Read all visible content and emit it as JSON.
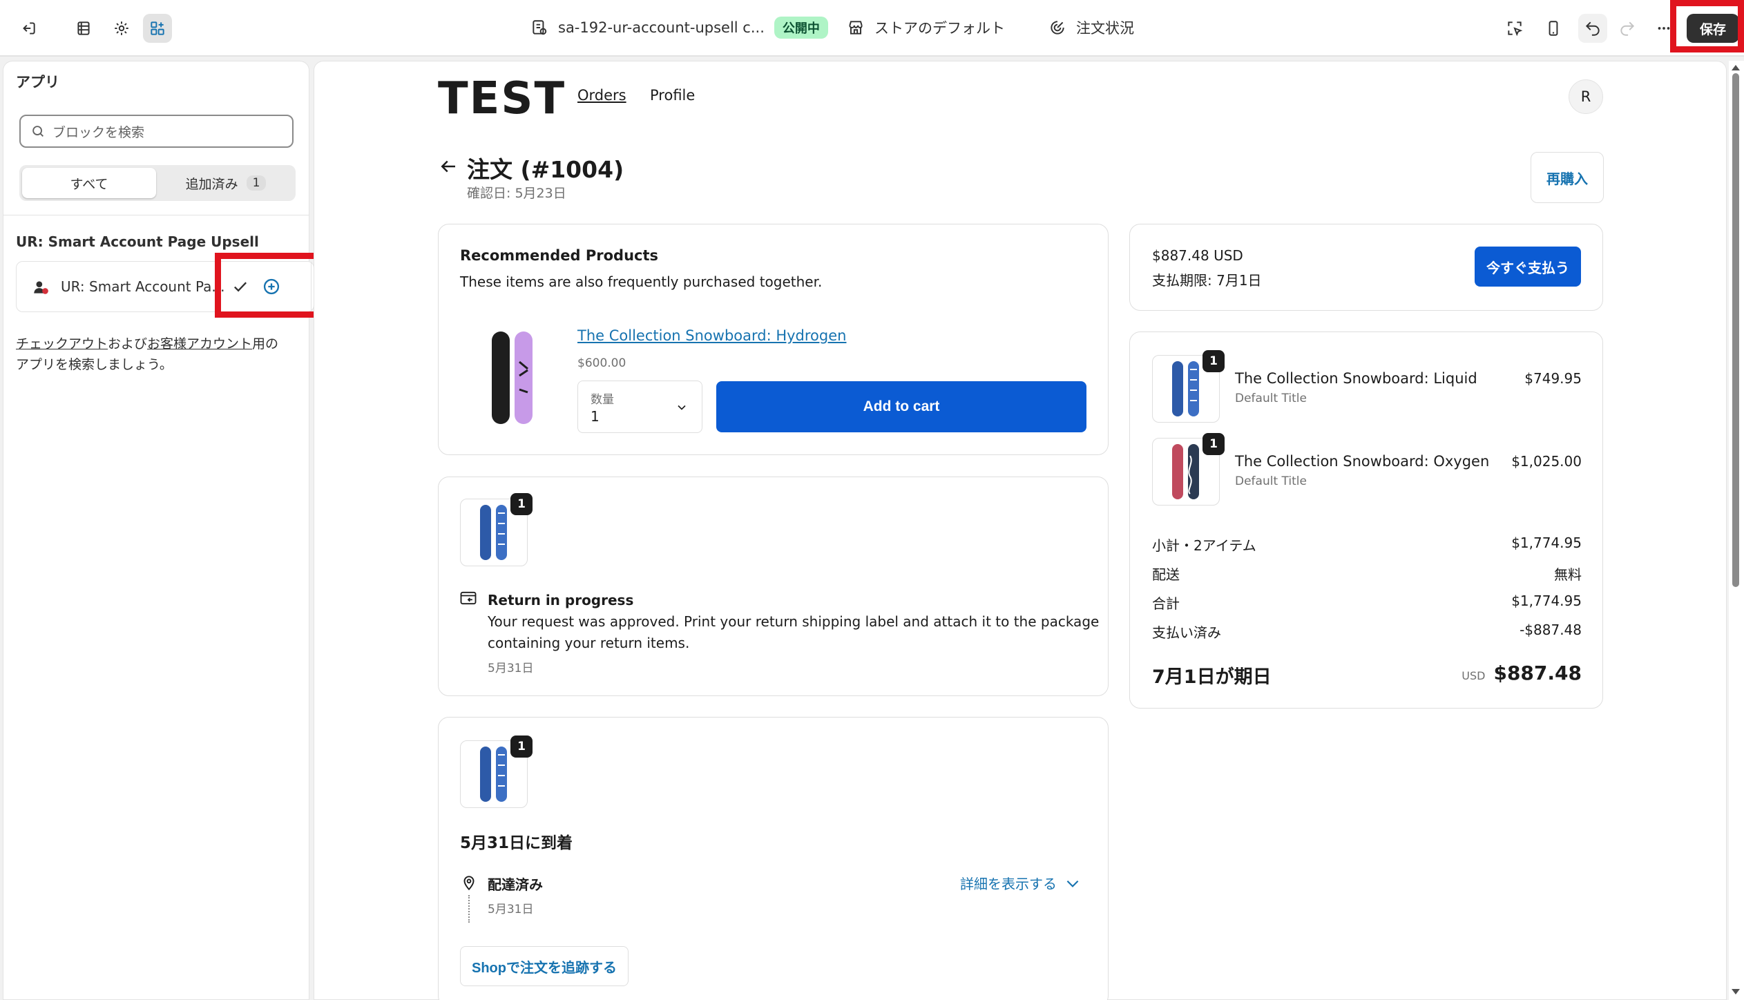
{
  "topbar": {
    "doc_title": "sa-192-ur-account-upsell c...",
    "status_badge": "公開中",
    "store_label": "ストアのデフォルト",
    "page_label": "注文状況",
    "save_label": "保存"
  },
  "sidebar": {
    "title": "アプリ",
    "search_placeholder": "ブロックを検索",
    "tab_all": "すべて",
    "tab_added": "追加済み",
    "tab_added_count": "1",
    "group_title": "UR: Smart Account Page Upsell",
    "block_label": "UR: Smart Account Pa...",
    "hint_link1": "チェックアウト",
    "hint_mid": "および",
    "hint_link2": "お客様アカウント",
    "hint_tail": "用の",
    "hint_line2": "アプリを検索しましょう。"
  },
  "store": {
    "logo": "TEST",
    "nav_orders": "Orders",
    "nav_profile": "Profile",
    "avatar_initial": "R"
  },
  "order": {
    "title": "注文 (#1004)",
    "confirmed": "確認日: 5月23日",
    "reorder_label": "再購入"
  },
  "recommended": {
    "heading": "Recommended Products",
    "subtitle": "These items are also frequently purchased together.",
    "product_name": "The Collection Snowboard: Hydrogen",
    "product_price": "$600.00",
    "qty_label": "数量",
    "qty_value": "1",
    "add_to_cart": "Add to cart"
  },
  "return": {
    "badge": "1",
    "title": "Return in progress",
    "line1": "Your request was approved. Print your return shipping label and attach it to the package",
    "line2": "containing your return items.",
    "date": "5月31日"
  },
  "delivery": {
    "badge": "1",
    "heading": "5月31日に到着",
    "status": "配達済み",
    "date": "5月31日",
    "details_link": "詳細を表示する",
    "track_button": "Shopで注文を追跡する"
  },
  "payment": {
    "amount": "$887.48 USD",
    "due": "支払期限: 7月1日",
    "pay_now": "今すぐ支払う"
  },
  "summary": {
    "items": [
      {
        "badge": "1",
        "name": "The Collection Snowboard: Liquid",
        "variant": "Default Title",
        "price": "$749.95"
      },
      {
        "badge": "1",
        "name": "The Collection Snowboard: Oxygen",
        "variant": "Default Title",
        "price": "$1,025.00"
      }
    ],
    "subtotal_label": "小計・2アイテム",
    "subtotal_value": "$1,774.95",
    "shipping_label": "配送",
    "shipping_value": "無料",
    "total_label": "合計",
    "total_value": "$1,774.95",
    "paid_label": "支払い済み",
    "paid_value": "-$887.48",
    "due_label": "7月1日が期日",
    "due_currency": "USD",
    "due_value": "$887.48"
  },
  "colors": {
    "accent_blue": "#0b5bd3",
    "link_blue": "#1773b0",
    "highlight_red": "#e0141e",
    "published_green": "#aff4c6"
  }
}
